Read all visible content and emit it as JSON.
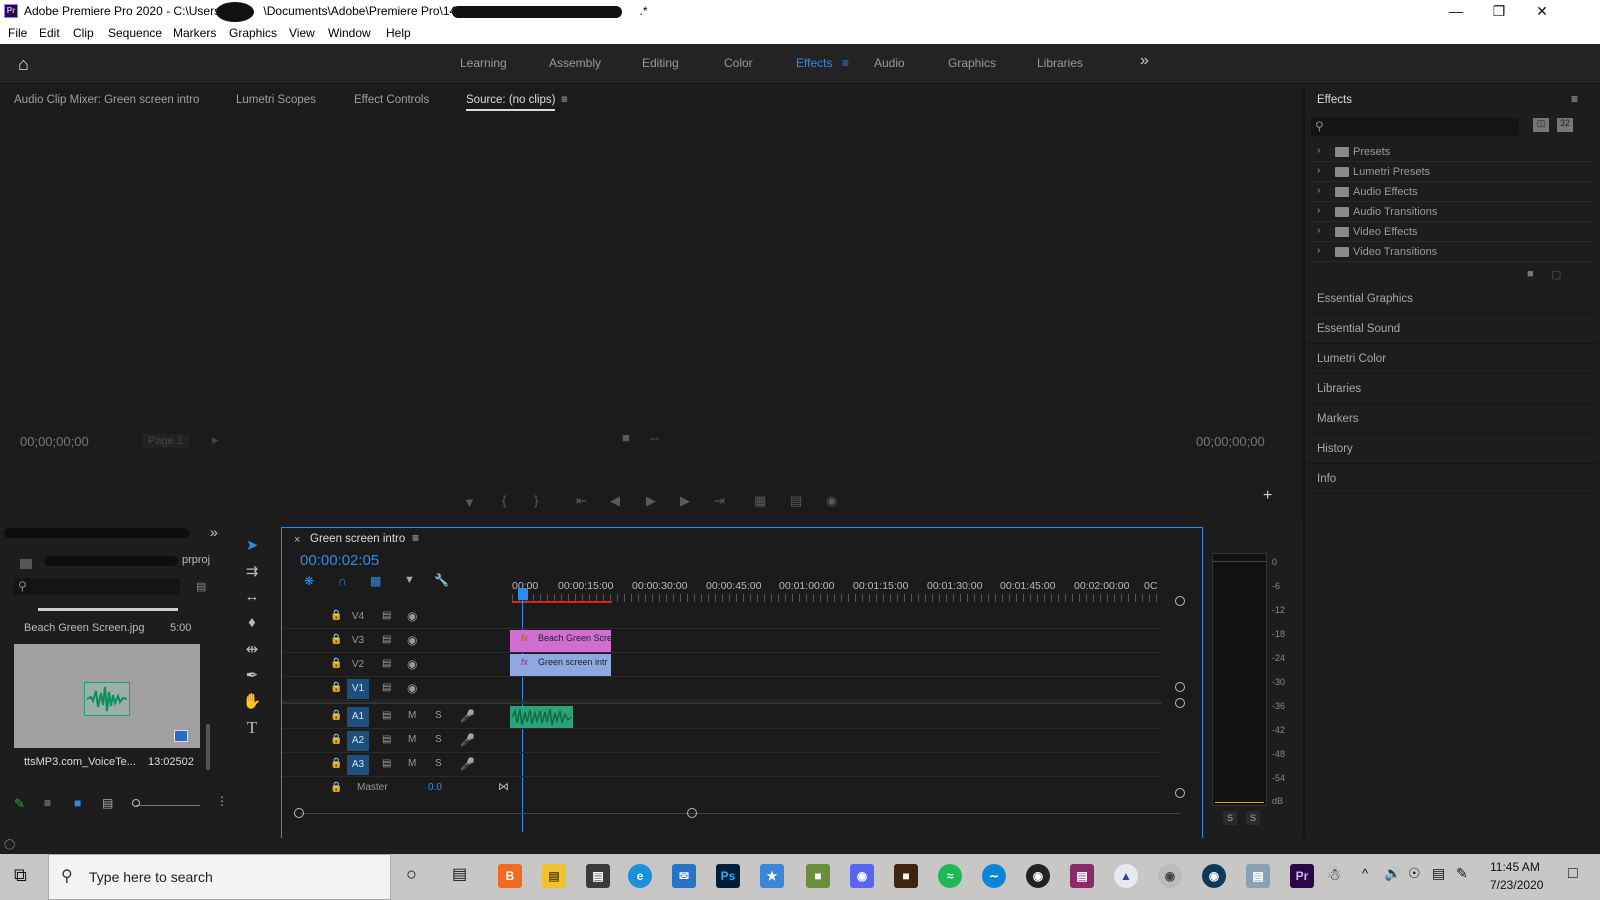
{
  "window": {
    "title": "Adobe Premiere Pro 2020 - C:\\Users\\",
    "title_mid": "\\Documents\\Adobe\\Premiere Pro\\14.0\\",
    "title_end": ".*",
    "logo": "Pr"
  },
  "menu": [
    "File",
    "Edit",
    "Clip",
    "Sequence",
    "Markers",
    "Graphics",
    "View",
    "Window",
    "Help"
  ],
  "workspaces": {
    "items": [
      "Learning",
      "Assembly",
      "Editing",
      "Color",
      "Effects",
      "Audio",
      "Graphics",
      "Libraries"
    ],
    "active": "Effects",
    "more": "»"
  },
  "source_panel": {
    "tabs": [
      "Audio Clip Mixer: Green screen intro",
      "Lumetri Scopes",
      "Effect Controls",
      "Source: (no clips)"
    ],
    "active_tab": "Source: (no clips)",
    "timecode_left": "00;00;00;00",
    "timecode_right": "00;00;00;00",
    "page": "Page 1"
  },
  "effects_panel": {
    "title": "Effects",
    "search_placeholder": "",
    "btn1": "32",
    "items": [
      "Presets",
      "Lumetri Presets",
      "Audio Effects",
      "Audio Transitions",
      "Video Effects",
      "Video Transitions"
    ],
    "side_panels": [
      "Essential Graphics",
      "Essential Sound",
      "Lumetri Color",
      "Libraries",
      "Markers",
      "History",
      "Info"
    ]
  },
  "project_panel": {
    "file_suffix": "prproj",
    "clip1_name": "Beach Green Screen.jpg",
    "clip1_duration": "5:00",
    "clip2_name": "ttsMP3.com_VoiceTe...",
    "clip2_duration": "13:02502"
  },
  "timeline": {
    "sequence_name": "Green screen intro",
    "timecode": "00:00:02:05",
    "ruler": [
      "00:00",
      "00:00:15:00",
      "00:00:30:00",
      "00:00:45:00",
      "00:01:00:00",
      "00:01:15:00",
      "00:01:30:00",
      "00:01:45:00",
      "00:02:00:00",
      "0C"
    ],
    "video_tracks": [
      "V4",
      "V3",
      "V2",
      "V1"
    ],
    "audio_tracks": [
      "A1",
      "A2",
      "A3"
    ],
    "master_label": "Master",
    "master_value": "0.0",
    "mute": "M",
    "solo": "S",
    "clip_v3": "Beach Green Scre",
    "clip_v2": "Green screen intr",
    "fx": "fx"
  },
  "meter": {
    "scale": [
      "0",
      "-6",
      "-12",
      "-18",
      "-24",
      "-30",
      "-36",
      "-42",
      "-48",
      "-54",
      "dB"
    ],
    "solo_left": "S",
    "solo_right": "S"
  },
  "taskbar": {
    "search_placeholder": "Type here to search",
    "time": "11:45 AM",
    "date": "7/23/2020"
  }
}
